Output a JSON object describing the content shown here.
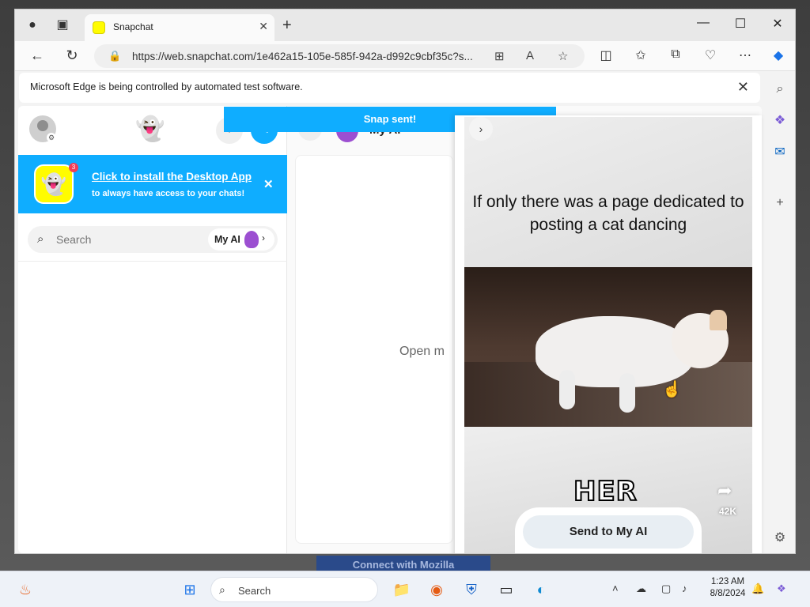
{
  "browser": {
    "tab_title": "Snapchat",
    "url": "https://web.snapchat.com/1e462a15-105e-585f-942a-d992c9cbf35c?s...",
    "infobar_text": "Microsoft Edge is being controlled by automated test software."
  },
  "sidebar": {
    "promo_title": "Click to install the Desktop App",
    "promo_subtitle": "to always have access to your chats!",
    "promo_badge": "3",
    "search_placeholder": "Search",
    "myai_chip_label": "My AI"
  },
  "chat": {
    "header_name": "My AI",
    "placeholder": "Open m"
  },
  "toast": "Snap sent!",
  "viewer": {
    "caption": "If only there was a page dedicated to posting a cat dancing",
    "overlay_text": "HER",
    "share_count": "42K",
    "send_button": "Send to My AI"
  },
  "desktop": {
    "behind_window_text": "Connect with Mozilla"
  },
  "taskbar": {
    "search_label": "Search",
    "time": "1:23 AM",
    "date": "8/8/2024"
  },
  "colors": {
    "snap_blue": "#0fadff",
    "snap_yellow": "#fffc00",
    "myai_purple": "#9c4fd1"
  }
}
